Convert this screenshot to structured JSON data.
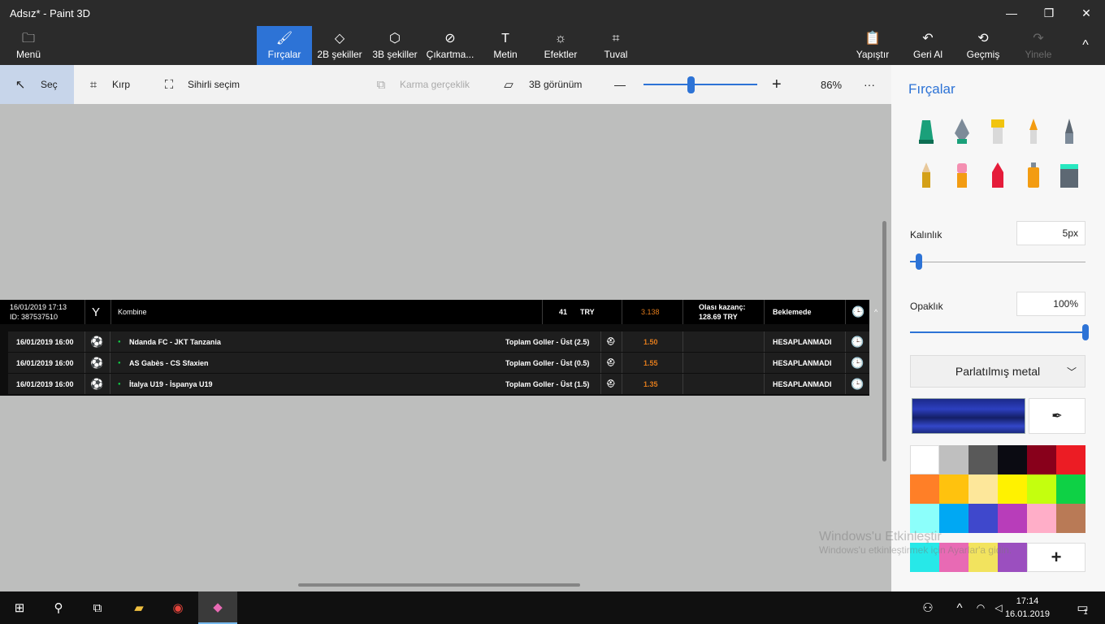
{
  "window": {
    "title": "Adsız* - Paint 3D",
    "minimize": "—",
    "restore": "❐",
    "close": "✕"
  },
  "ribbon": {
    "menu": {
      "label": "Menü",
      "icon": "folder-icon"
    },
    "tabs": [
      {
        "label": "Fırçalar",
        "icon": "brush-icon",
        "active": true
      },
      {
        "label": "2B şekiller",
        "icon": "shapes-2d-icon"
      },
      {
        "label": "3B şekiller",
        "icon": "cube-icon"
      },
      {
        "label": "Çıkartma...",
        "icon": "sticker-icon"
      },
      {
        "label": "Metin",
        "icon": "text-icon"
      },
      {
        "label": "Efektler",
        "icon": "effects-icon"
      },
      {
        "label": "Tuval",
        "icon": "canvas-icon"
      }
    ],
    "paste": "Yapıştır",
    "undo": "Geri Al",
    "history": "Geçmiş",
    "redo": "Yinele",
    "collapse": "^"
  },
  "toolbar": {
    "select": "Seç",
    "crop": "Kırp",
    "magic_select": "Sihirli seçim",
    "mixed_reality": "Karma gerçeklik",
    "view_3d": "3B görünüm",
    "zoom_minus": "—",
    "zoom_plus": "+",
    "zoom_percent": "86%",
    "more": "···"
  },
  "bet": {
    "header": {
      "datetime": "16/01/2019 17:13",
      "id": "ID: 387537510",
      "type": "Kombine",
      "amount": "41",
      "currency": "TRY",
      "odds": "3.138",
      "potential_label": "Olası kazanç:",
      "potential_value": "128.69 TRY",
      "status": "Beklemede",
      "collapse": "^"
    },
    "rows": [
      {
        "datetime": "16/01/2019 16:00",
        "match": "Ndanda FC - JKT Tanzania",
        "market": "Toplam Goller - Üst (2.5)",
        "odds": "1.50",
        "status": "HESAPLANMADI"
      },
      {
        "datetime": "16/01/2019 16:00",
        "match": "AS Gabès - CS Sfaxien",
        "market": "Toplam Goller - Üst (0.5)",
        "odds": "1.55",
        "status": "HESAPLANMADI"
      },
      {
        "datetime": "16/01/2019 16:00",
        "match": "İtalya U19 - İspanya U19",
        "market": "Toplam Goller - Üst (1.5)",
        "odds": "1.35",
        "status": "HESAPLANMADI"
      }
    ]
  },
  "sidebar": {
    "title": "Fırçalar",
    "thickness_label": "Kalınlık",
    "thickness_value": "5px",
    "thickness_fraction": 0.05,
    "opacity_label": "Opaklık",
    "opacity_value": "100%",
    "opacity_fraction": 1.0,
    "material": "Parlatılmış metal",
    "colors": [
      "#ffffff",
      "#bfbfbf",
      "#595959",
      "#0b0b12",
      "#88001b",
      "#ec1c24",
      "#ff7f27",
      "#ffc20e",
      "#fde79a",
      "#fff200",
      "#c4ff0e",
      "#0ed145",
      "#8cfffb",
      "#00a8f3",
      "#3f48cc",
      "#b83dba",
      "#ffaec8",
      "#b97a56",
      "#27e8e8",
      "#e86ab4",
      "#f2e35e",
      "#9b4fbf"
    ],
    "add_color": "+"
  },
  "watermark": {
    "line1": "Windows'u Etkinleştir",
    "line2": "Windows'u etkinleştirmek için Ayarlar'a gidin."
  },
  "taskbar": {
    "time": "17:14",
    "date": "16.01.2019",
    "notifications": "1"
  }
}
